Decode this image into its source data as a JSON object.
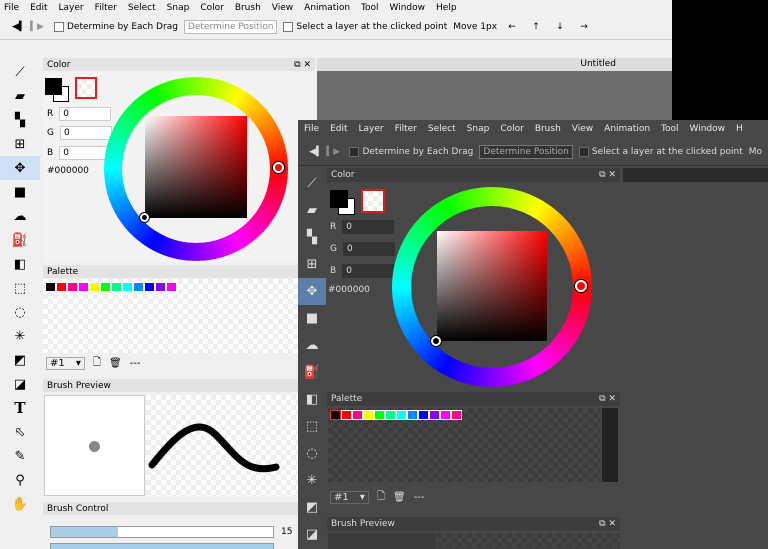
{
  "menu": [
    "File",
    "Edit",
    "Layer",
    "Filter",
    "Select",
    "Snap",
    "Color",
    "Brush",
    "View",
    "Animation",
    "Tool",
    "Window",
    "Help"
  ],
  "dark_menu": [
    "File",
    "Edit",
    "Layer",
    "Filter",
    "Select",
    "Snap",
    "Color",
    "Brush",
    "View",
    "Animation",
    "Tool",
    "Window",
    "H"
  ],
  "toolbar": {
    "prev": "◀▍",
    "next": "▍▶",
    "determine_drag": "Determine by Each Drag",
    "determine_position": "Determine Position",
    "select_layer": "Select a layer at the clicked point",
    "move": "Move 1px",
    "dark_move": "Mo",
    "arrows": [
      "←",
      "↑",
      "↓",
      "→"
    ]
  },
  "canvas_tab": "Untitled",
  "color_panel": {
    "title": "Color",
    "r_label": "R",
    "r_value": "0",
    "g_label": "G",
    "g_value": "0",
    "b_label": "B",
    "b_value": "0",
    "hex": "#000000",
    "fg_color": "#000000",
    "bg_color": "#ffffff"
  },
  "palette_panel": {
    "title": "Palette",
    "colors": [
      "#000000",
      "#ff0000",
      "#ff00aa",
      "#ff00ff",
      "#ffff00",
      "#00ff00",
      "#00ffaa",
      "#00ffff",
      "#00aaff",
      "#0000ff",
      "#aa00ff",
      "#ff00ff",
      "#ff0088"
    ],
    "selector": "#1",
    "dash": "---"
  },
  "brush_preview_panel": {
    "title": "Brush Preview"
  },
  "brush_control_panel": {
    "title": "Brush Control",
    "size_value": "15"
  },
  "panel_controls": {
    "float": "⧉",
    "close": "✕"
  },
  "tools": [
    "brush-icon",
    "eraser-icon",
    "dots-icon",
    "grid-icon",
    "move-icon",
    "rect-icon",
    "cloud-icon",
    "fill-icon",
    "gradient-icon",
    "select-rect-icon",
    "lasso-icon",
    "magic-wand-icon",
    "select-pen-icon",
    "select-eraser-icon",
    "text-icon",
    "arrow-icon",
    "pen-icon",
    "eyedropper-icon",
    "hand-icon"
  ],
  "tool_glyphs": [
    "⟋",
    "▰",
    "▚",
    "⊞",
    "✥",
    "■",
    "☁",
    "⛽",
    "◧",
    "⬚",
    "◌",
    "✳",
    "◩",
    "◪",
    "T",
    "⬁",
    "✎",
    "⚲",
    "✋"
  ]
}
